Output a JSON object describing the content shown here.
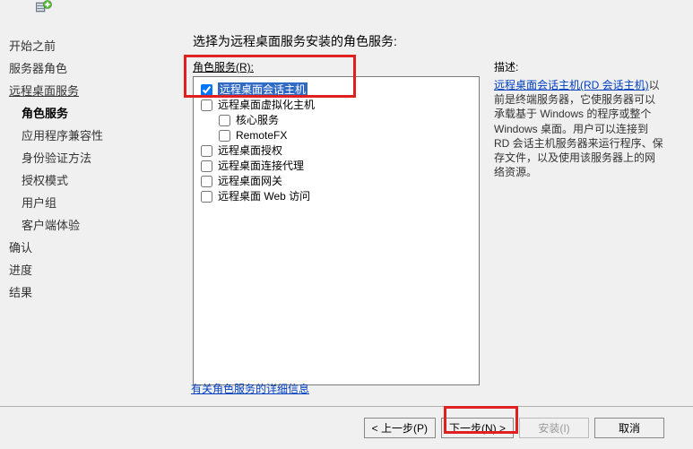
{
  "icon": "server-add-icon",
  "nav": {
    "items": [
      {
        "label": "开始之前"
      },
      {
        "label": "服务器角色"
      },
      {
        "label": "远程桌面服务",
        "underline": true
      },
      {
        "label": "角色服务",
        "indent": true,
        "selected": true
      },
      {
        "label": "应用程序兼容性",
        "indent": true
      },
      {
        "label": "身份验证方法",
        "indent": true
      },
      {
        "label": "授权模式",
        "indent": true
      },
      {
        "label": "用户组",
        "indent": true
      },
      {
        "label": "客户端体验",
        "indent": true
      },
      {
        "label": "确认"
      },
      {
        "label": "进度"
      },
      {
        "label": "结果"
      }
    ]
  },
  "main": {
    "heading": "选择为远程桌面服务安装的角色服务:",
    "subhead": "角色服务(R):",
    "tree": [
      {
        "label": "远程桌面会话主机",
        "checked": true,
        "selected": true,
        "indent": 0
      },
      {
        "label": "远程桌面虚拟化主机",
        "checked": false,
        "indent": 0
      },
      {
        "label": "核心服务",
        "checked": false,
        "indent": 1
      },
      {
        "label": "RemoteFX",
        "checked": false,
        "indent": 1
      },
      {
        "label": "远程桌面授权",
        "checked": false,
        "indent": 0
      },
      {
        "label": "远程桌面连接代理",
        "checked": false,
        "indent": 0
      },
      {
        "label": "远程桌面网关",
        "checked": false,
        "indent": 0
      },
      {
        "label": "远程桌面 Web 访问",
        "checked": false,
        "indent": 0
      }
    ],
    "details_link": "有关角色服务的详细信息",
    "desc": {
      "head": "描述:",
      "link": "远程桌面会话主机(RD 会话主机)",
      "text": "以前是终端服务器，它使服务器可以承载基于 Windows 的程序或整个 Windows 桌面。用户可以连接到 RD 会话主机服务器来运行程序、保存文件，以及使用该服务器上的网络资源。"
    }
  },
  "buttons": {
    "prev": "< 上一步(P)",
    "next": "下一步(N) >",
    "install": "安装(I)",
    "cancel": "取消"
  }
}
